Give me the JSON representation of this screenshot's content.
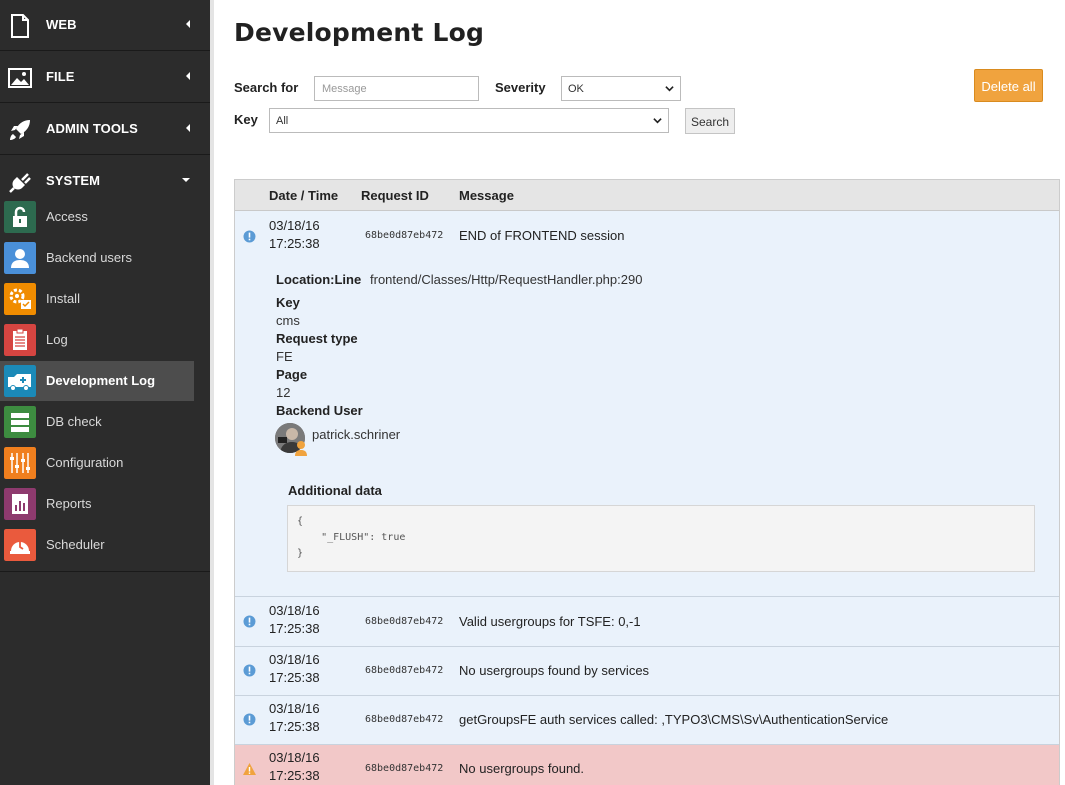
{
  "sidebar": {
    "groups": [
      {
        "label": "WEB",
        "icon": "page-icon"
      },
      {
        "label": "FILE",
        "icon": "image-icon"
      },
      {
        "label": "ADMIN TOOLS",
        "icon": "rocket-icon"
      },
      {
        "label": "SYSTEM",
        "icon": "plug-icon"
      }
    ],
    "modules": [
      {
        "label": "Access",
        "icon": "lock-icon",
        "color": "#2d6a4f"
      },
      {
        "label": "Backend users",
        "icon": "user-icon",
        "color": "#4a90d9"
      },
      {
        "label": "Install",
        "icon": "install-icon",
        "color": "#f08c00"
      },
      {
        "label": "Log",
        "icon": "clipboard-icon",
        "color": "#d64541"
      },
      {
        "label": "Development Log",
        "icon": "ambulance-icon",
        "color": "#1b8ab8"
      },
      {
        "label": "DB check",
        "icon": "database-icon",
        "color": "#3d8c40"
      },
      {
        "label": "Configuration",
        "icon": "sliders-icon",
        "color": "#f07f1e"
      },
      {
        "label": "Reports",
        "icon": "report-icon",
        "color": "#8e3a6e"
      },
      {
        "label": "Scheduler",
        "icon": "scheduler-icon",
        "color": "#ea5a3d"
      }
    ]
  },
  "page": {
    "title": "Development Log"
  },
  "filters": {
    "search_label": "Search for",
    "search_placeholder": "Message",
    "severity_label": "Severity",
    "severity_value": "OK",
    "key_label": "Key",
    "key_value": "All",
    "search_button": "Search",
    "delete_button": "Delete all"
  },
  "table": {
    "headers": {
      "date": "Date / Time",
      "request": "Request ID",
      "message": "Message"
    },
    "expanded": {
      "date": "03/18/16",
      "time": "17:25:38",
      "request_id": "68be0d87eb472",
      "message": "END of FRONTEND session",
      "location_label": "Location:Line",
      "location_value": "frontend/Classes/Http/RequestHandler.php:290",
      "key_label": "Key",
      "key_value": "cms",
      "request_type_label": "Request type",
      "request_type_value": "FE",
      "page_label": "Page",
      "page_value": "12",
      "backend_user_label": "Backend User",
      "backend_user_value": "patrick.schriner",
      "additional_label": "Additional data",
      "additional_line1": "{",
      "additional_line2": "    \"_FLUSH\": true",
      "additional_line3": "}"
    },
    "rows": [
      {
        "date": "03/18/16",
        "time": "17:25:38",
        "request_id": "68be0d87eb472",
        "message": "Valid usergroups for TSFE: 0,-1",
        "severity": "info"
      },
      {
        "date": "03/18/16",
        "time": "17:25:38",
        "request_id": "68be0d87eb472",
        "message": "No usergroups found by services",
        "severity": "info"
      },
      {
        "date": "03/18/16",
        "time": "17:25:38",
        "request_id": "68be0d87eb472",
        "message": "getGroupsFE auth services called: ,TYPO3\\CMS\\Sv\\AuthenticationService",
        "severity": "info"
      },
      {
        "date": "03/18/16",
        "time": "17:25:38",
        "request_id": "68be0d87eb472",
        "message": "No usergroups found.",
        "severity": "warning"
      }
    ]
  },
  "colors": {
    "info": "#5b9bd5",
    "warning": "#f0a33e",
    "accent": "#f0a33e"
  }
}
